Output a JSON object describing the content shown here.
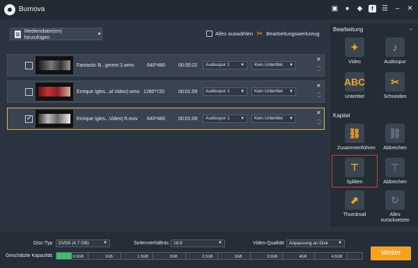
{
  "app": {
    "title": "Burnova"
  },
  "toolbar": {
    "add_label": "Mediendatei(en) hinzufügen",
    "select_all": "Alles auswählen",
    "edit_tool": "Bearbeitungswerkzeug"
  },
  "videos": [
    {
      "name": "Fantastic B...gment 2.wmv",
      "resolution": "640*480",
      "duration": "00:00:22",
      "audio": "Audiospur 1",
      "subtitle": "Kein Untertitel",
      "checked": false
    },
    {
      "name": "Enrique Igles...al Video).wmv",
      "resolution": "1280*720",
      "duration": "00:01:59",
      "audio": "Audiospur 1",
      "subtitle": "Kein Untertitel",
      "checked": false
    },
    {
      "name": "Enrique Igles...Video) ft.mov",
      "resolution": "640*480",
      "duration": "00:01:09",
      "audio": "Audiospur 1",
      "subtitle": "Kein Untertitel",
      "checked": true
    }
  ],
  "panel": {
    "section_edit": "Bearbeitung",
    "section_chapter": "Kapitel",
    "edit_tools": [
      "Video",
      "Audiospur",
      "Untertitel",
      "Schneiden"
    ],
    "chapter_tools": [
      "Zusammenführen",
      "Abbrechen",
      "Splitten",
      "Abbrechen",
      "Thumbnail",
      "Alles zurücksetzen"
    ],
    "abc_text": "ABC"
  },
  "bottom": {
    "disc_type_label": "Disc-Typ",
    "disc_type_value": "DVD5 (4.7 GB)",
    "aspect_label": "Seitenverhältnis:",
    "aspect_value": "16:9",
    "quality_label": "Video-Qualität:",
    "quality_value": "Anpassung an Disk",
    "capacity_label": "Geschätzte Kapazität:",
    "capacity_ticks": [
      "0.5GB",
      "1GB",
      "1.5GB",
      "2GB",
      "2.5GB",
      "3GB",
      "3.5GB",
      "4GB",
      "4.5GB"
    ],
    "capacity_fill_fraction": 0.05,
    "next_label": "Weiter"
  },
  "colors": {
    "accent": "#f5a21e",
    "capacity": "#39c06a",
    "highlight": "#d94040"
  }
}
